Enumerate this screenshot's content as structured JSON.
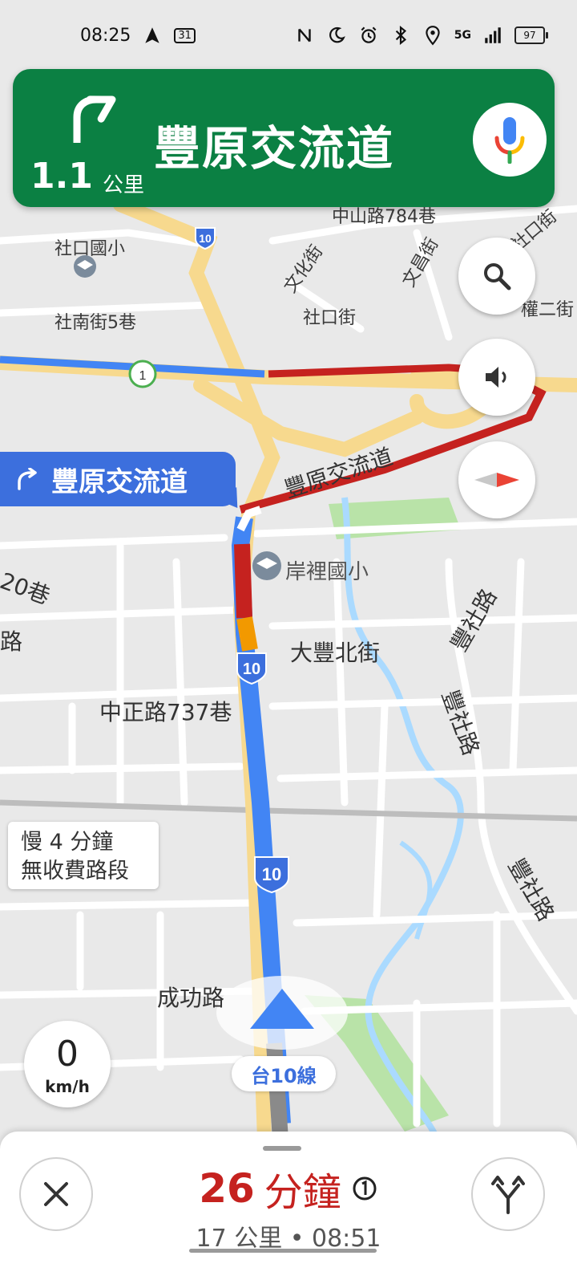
{
  "status_bar": {
    "time": "08:25",
    "calendar_badge": "31",
    "network": "5G",
    "battery": "97"
  },
  "nav_banner": {
    "distance_value": "1.1",
    "distance_unit": "公里",
    "instruction": "豐原交流道",
    "turn_icon": "turn-right-arrow-icon",
    "bg_color": "#0b8043"
  },
  "map": {
    "callout": "豐原交流道",
    "roads": {
      "shekou_elementary": "社口國小",
      "shenan_5": "社南街5巷",
      "wenhua": "文化街",
      "wenchang": "文昌街",
      "shekou_st": "社口街",
      "shekou_st2": "社口街",
      "quan_er": "權二街",
      "zhongshan_784": "中山路784巷",
      "exit_road": "豐原交流道",
      "anli_elementary": "岸裡國小",
      "dafeng_north": "大豐北街",
      "fengshe_1": "豐社路",
      "fengshe_2": "豐社路",
      "fengshe_3": "豐社路",
      "zhongzheng_737": "中正路737巷",
      "lane_20": "20巷",
      "chenggong": "成功路",
      "lu_left": "路"
    },
    "shields": [
      "10",
      "10",
      "10",
      "1"
    ],
    "route_info_line1": "慢 4 分鐘",
    "route_info_line2": "無收費路段",
    "speed_value": "0",
    "speed_unit": "km/h",
    "current_road": "台10線",
    "route_color": "#4285f4",
    "traffic_red": "#c5221f",
    "traffic_orange": "#f29900",
    "highway_color": "#f7d98e"
  },
  "bottom": {
    "eta_minutes": "26",
    "eta_unit": "分鐘",
    "eta_details": "17 公里 • 08:51",
    "close_icon": "close-icon",
    "alt_routes_icon": "alternate-routes-icon"
  }
}
